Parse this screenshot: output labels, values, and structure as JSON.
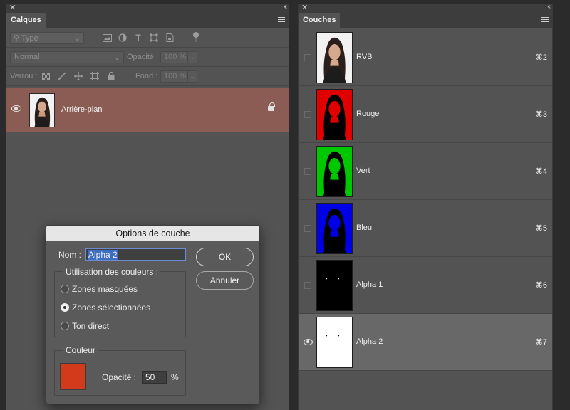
{
  "layers_panel": {
    "tab_label": "Calques",
    "close_glyph": "✕",
    "collapse_glyph": "‹‹",
    "search_placeholder": "Type",
    "blend_mode": "Normal",
    "opacity_label": "Opacité :",
    "opacity_value": "100 %",
    "lock_label": "Verrou :",
    "fill_label": "Fond :",
    "fill_value": "100 %",
    "filter_icons": [
      "image-filter-icon",
      "adjustment-filter-icon",
      "type-filter-icon",
      "shape-filter-icon",
      "smart-object-filter-icon"
    ],
    "lock_icons": [
      "lock-transparent-pixels-icon",
      "lock-image-pixels-icon",
      "lock-position-icon",
      "lock-artboard-icon",
      "lock-all-icon"
    ],
    "layer": {
      "name": "Arrière-plan",
      "locked": true
    }
  },
  "channels_panel": {
    "tab_label": "Couches",
    "close_glyph": "✕",
    "collapse_glyph": "‹‹",
    "channels": [
      {
        "name": "RVB",
        "shortcut": "⌘2",
        "thumb": "color"
      },
      {
        "name": "Rouge",
        "shortcut": "⌘3",
        "thumb": "#e00000"
      },
      {
        "name": "Vert",
        "shortcut": "⌘4",
        "thumb": "#00c800"
      },
      {
        "name": "Bleu",
        "shortcut": "⌘5",
        "thumb": "#0000e6"
      },
      {
        "name": "Alpha 1",
        "shortcut": "⌘6",
        "thumb": "#000000",
        "dots": "#ffffff"
      },
      {
        "name": "Alpha 2",
        "shortcut": "⌘7",
        "thumb": "#ffffff",
        "dots": "#000000",
        "selected": true,
        "visible": true
      }
    ]
  },
  "dialog": {
    "title": "Options de couche",
    "name_label": "Nom :",
    "name_value": "Alpha 2",
    "ok_label": "OK",
    "cancel_label": "Annuler",
    "color_usage_legend": "Utilisation des couleurs :",
    "options": [
      {
        "label": "Zones masquées",
        "checked": false
      },
      {
        "label": "Zones sélectionnées",
        "checked": true
      },
      {
        "label": "Ton direct",
        "checked": false
      }
    ],
    "color_legend": "Couleur",
    "color_swatch": "#d33a1c",
    "opacity_label": "Opacité :",
    "opacity_value": "50",
    "opacity_unit": "%"
  }
}
